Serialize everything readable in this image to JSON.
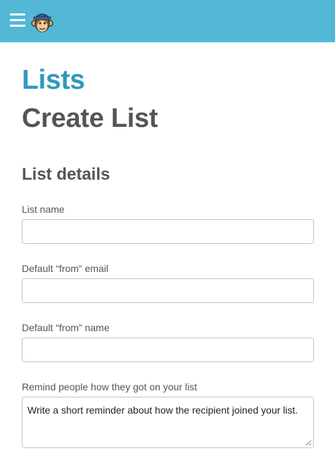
{
  "topbar": {
    "menu_icon": "hamburger-menu-icon",
    "logo_icon": "monkey-mascot-logo"
  },
  "header": {
    "breadcrumb": "Lists",
    "title": "Create List"
  },
  "form": {
    "section_title": "List details",
    "fields": [
      {
        "label": "List name",
        "value": ""
      },
      {
        "label": "Default “from” email",
        "value": ""
      },
      {
        "label": "Default “from” name",
        "value": ""
      }
    ],
    "reminder": {
      "label": "Remind people how they got on your list",
      "placeholder": "Write a short reminder about how the recipient joined your list."
    }
  },
  "colors": {
    "topbar": "#52b8d6",
    "link": "#3198bd",
    "heading": "#555555"
  }
}
